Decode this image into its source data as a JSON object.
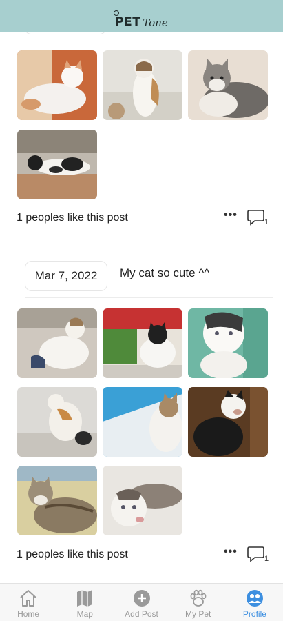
{
  "header": {
    "logo_pet": "PET",
    "logo_tone": "Tone"
  },
  "posts": [
    {
      "photos": [
        "cat-photo-1",
        "cat-photo-2",
        "cat-photo-3",
        "cat-photo-4"
      ],
      "likes": "1 peoples like this post",
      "more": "•••",
      "comment_count": "1"
    },
    {
      "date": "Mar 7, 2022",
      "caption": "My cat so cute ^^",
      "photos": [
        "cat-photo-5",
        "cat-photo-6",
        "cat-photo-7",
        "cat-photo-8",
        "cat-photo-9",
        "cat-photo-10",
        "cat-photo-11",
        "cat-photo-12"
      ],
      "likes": "1 peoples like this post",
      "more": "•••",
      "comment_count": "1"
    }
  ],
  "tabs": [
    {
      "label": "Home",
      "icon": "home-icon",
      "active": false
    },
    {
      "label": "Map",
      "icon": "map-icon",
      "active": false
    },
    {
      "label": "Add Post",
      "icon": "add-icon",
      "active": false
    },
    {
      "label": "My Pet",
      "icon": "paw-icon",
      "active": false
    },
    {
      "label": "Profile",
      "icon": "profile-icon",
      "active": true
    }
  ],
  "colors": {
    "header": "#a7cfcf",
    "accent": "#3d8fe0",
    "inactive": "#9a9a9a"
  }
}
